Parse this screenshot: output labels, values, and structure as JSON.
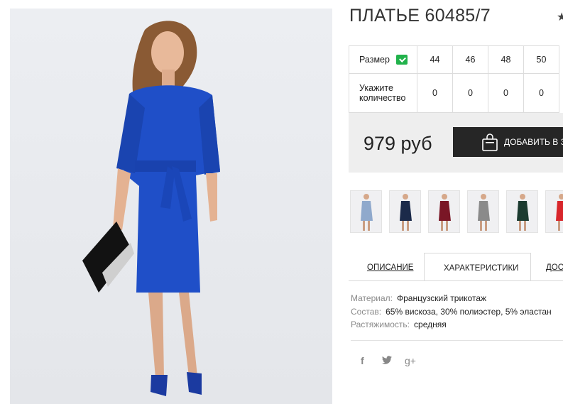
{
  "product": {
    "title": "ПЛАТЬЕ 60485/7",
    "favorite_icon": "star-icon"
  },
  "size_table": {
    "size_label": "Размер",
    "size_icon": "size-guide-icon",
    "quantity_label": "Укажите количество",
    "sizes": [
      "44",
      "46",
      "48",
      "50"
    ],
    "quantities": [
      "0",
      "0",
      "0",
      "0"
    ]
  },
  "purchase": {
    "price": "979 руб",
    "add_button_label": "ДОБАВИТЬ В ЗА",
    "add_button_icon": "shopping-bag-icon"
  },
  "thumbnails": [
    {
      "dress_color": "#8fa9cc"
    },
    {
      "dress_color": "#1b2a4a"
    },
    {
      "dress_color": "#7a1626"
    },
    {
      "dress_color": "#8a8a8a"
    },
    {
      "dress_color": "#1c3b30"
    },
    {
      "dress_color": "#d8262b"
    }
  ],
  "tabs": {
    "description": "ОПИСАНИЕ",
    "characteristics": "ХАРАКТЕРИСТИКИ",
    "delivery": "ДОС"
  },
  "specs": [
    {
      "key": "Материал:",
      "value": "Французский трикотаж"
    },
    {
      "key": "Состав:",
      "value": "65% вискоза, 30% полиэстер, 5% эластан"
    },
    {
      "key": "Растяжимость:",
      "value": "средняя"
    }
  ],
  "social": {
    "facebook": "f",
    "twitter": "twitter-icon",
    "googleplus": "g+"
  },
  "colors": {
    "dress": "#1f4fc8",
    "button": "#262626",
    "buy_box": "#eeeeee",
    "size_icon": "#21b24b"
  }
}
